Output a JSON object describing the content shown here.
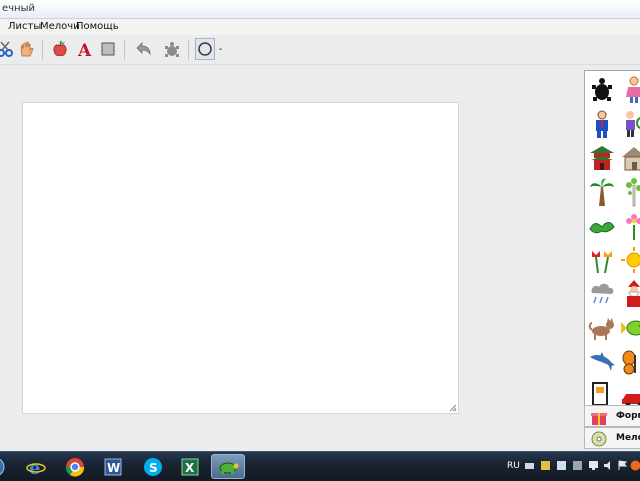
{
  "window": {
    "title_fragment": "ечный"
  },
  "menu": {
    "items": [
      "Листы",
      "Мелочи",
      "Помощь"
    ]
  },
  "toolbar": {
    "buttons": [
      "scissors-icon",
      "hand-icon",
      "apple-icon",
      "text-a-icon",
      "fill-square-icon",
      "undo-icon",
      "turtle-shape-icon",
      "ellipse-tool-icon"
    ],
    "text_color": "#c0142b",
    "dropdown_label": "-"
  },
  "palette": {
    "items": [
      "turtle",
      "girl",
      "man",
      "boy-with-racket",
      "pagoda",
      "house",
      "palm-tree",
      "birch-tree",
      "bush",
      "flower",
      "tulips",
      "sun",
      "rain-cloud",
      "santa-claus",
      "cat",
      "fish",
      "dolphin",
      "butterfly",
      "robot",
      "car"
    ],
    "tabs": [
      {
        "label": "Форм",
        "icon": "gift-icon"
      },
      {
        "label": "Мелоч",
        "icon": "cd-disc-icon"
      }
    ]
  },
  "taskbar": {
    "apps": [
      "start-button",
      "internet-explorer-icon",
      "chrome-icon",
      "word-icon",
      "skype-icon",
      "excel-icon",
      "turtle-app-icon"
    ],
    "language": "RU"
  }
}
